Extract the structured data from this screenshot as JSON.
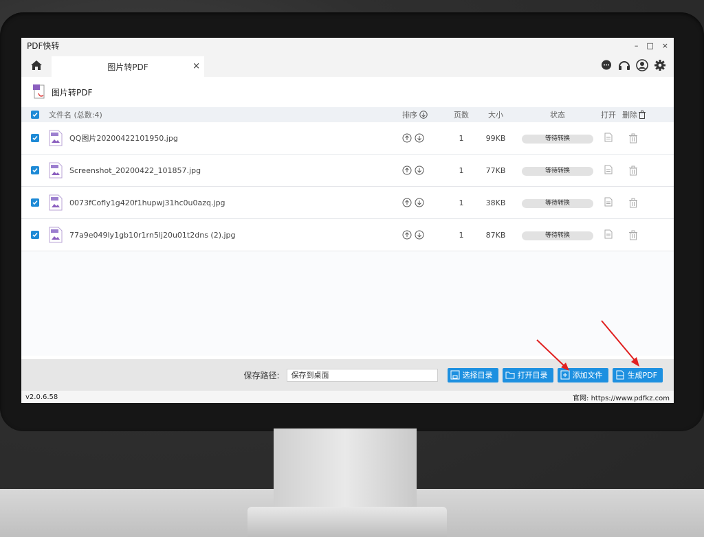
{
  "app": {
    "title": "PDF快转",
    "window_controls": {
      "minimize": "–",
      "maximize": "□",
      "close": "×"
    }
  },
  "tabs": [
    {
      "label": "图片转PDF",
      "close": "×"
    }
  ],
  "section": {
    "title": "图片转PDF"
  },
  "table": {
    "headers": {
      "name": "文件名 (总数:4)",
      "sort": "排序",
      "pages": "页数",
      "size": "大小",
      "status": "状态",
      "open": "打开",
      "delete": "删除"
    },
    "rows": [
      {
        "name": "QQ图片20200422101950.jpg",
        "pages": "1",
        "size": "99KB",
        "status": "等待转换"
      },
      {
        "name": "Screenshot_20200422_101857.jpg",
        "pages": "1",
        "size": "77KB",
        "status": "等待转换"
      },
      {
        "name": "0073fCofly1g420f1hupwj31hc0u0azq.jpg",
        "pages": "1",
        "size": "38KB",
        "status": "等待转换"
      },
      {
        "name": "77a9e049ly1gb10r1rn5lj20u01t2dns (2).jpg",
        "pages": "1",
        "size": "87KB",
        "status": "等待转换"
      }
    ]
  },
  "bottom": {
    "path_label": "保存路径:",
    "path_value": "保存到桌面",
    "buttons": {
      "select_dir": "选择目录",
      "open_dir": "打开目录",
      "add_file": "添加文件",
      "generate_pdf": "生成PDF"
    }
  },
  "statusbar": {
    "version": "v2.0.6.58",
    "website": "官网: https://www.pdfkz.com"
  },
  "colors": {
    "accent": "#1d90e0",
    "annotation_arrow": "#e02020"
  }
}
